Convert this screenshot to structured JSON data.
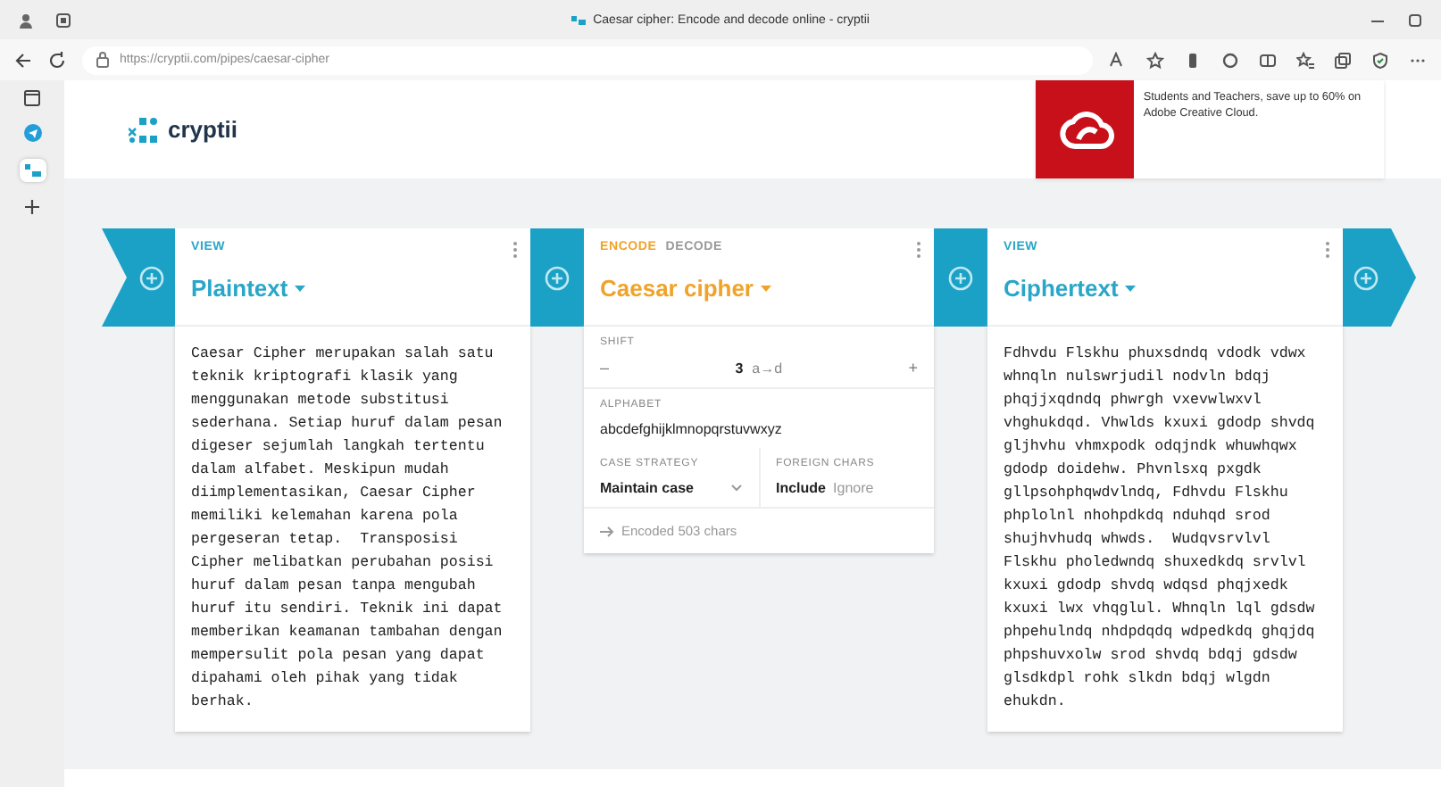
{
  "browser": {
    "title": "Caesar cipher: Encode and decode online - cryptii",
    "url": "https://cryptii.com/pipes/caesar-cipher"
  },
  "site": {
    "logo": "cryptii",
    "ad": {
      "text": "Students and Teachers, save up to 60% on Adobe Creative Cloud."
    }
  },
  "pipeline": [
    {
      "kind": "view",
      "label": "VIEW",
      "title": "Plaintext",
      "content": "Caesar Cipher merupakan salah satu teknik kriptografi klasik yang menggunakan metode substitusi sederhana. Setiap huruf dalam pesan digeser sejumlah langkah tertentu dalam alfabet. Meskipun mudah diimplementasikan, Caesar Cipher memiliki kelemahan karena pola pergeseran tetap.  Transposisi Cipher melibatkan perubahan posisi huruf dalam pesan tanpa mengubah huruf itu sendiri. Teknik ini dapat memberikan keamanan tambahan dengan mempersulit pola pesan yang dapat dipahami oleh pihak yang tidak berhak."
    },
    {
      "kind": "encoder",
      "modes": [
        {
          "label": "ENCODE",
          "selected": true
        },
        {
          "label": "DECODE",
          "selected": false
        }
      ],
      "title": "Caesar cipher",
      "shift": {
        "label": "SHIFT",
        "decrement": "–",
        "value": "3",
        "mapping": "a→d",
        "increment": "+"
      },
      "alphabet": {
        "label": "ALPHABET",
        "value": "abcdefghijklmnopqrstuvwxyz"
      },
      "case_strategy": {
        "label": "CASE STRATEGY",
        "value": "Maintain case"
      },
      "foreign_chars": {
        "label": "FOREIGN CHARS",
        "options": [
          {
            "label": "Include",
            "selected": true
          },
          {
            "label": "Ignore",
            "selected": false
          }
        ]
      },
      "status": "Encoded 503 chars"
    },
    {
      "kind": "view",
      "label": "VIEW",
      "title": "Ciphertext",
      "content": "Fdhvdu Flskhu phuxsdndq vdodk vdwx whnqln nulswrjudil nodvln bdqj phqjjxqdndq phwrgh vxevwlwxvl vhghukdqd. Vhwlds kxuxi gdodp shvdq gljhvhu vhmxpodk odqjndk whuwhqwx gdodp doidehw. Phvnlsxq pxgdk gllpsohphqwdvlndq, Fdhvdu Flskhu phplolnl nhohpdkdq nduhqd srod shujhvhudq whwds.  Wudqvsrvlvl Flskhu pholedwndq shuxedkdq srvlvl kxuxi gdodp shvdq wdqsd phqjxedk kxuxi lwx vhqglul. Whnqln lql gdsdw phpehulndq nhdpdqdq wdpedkdq ghqjdq phpshuvxolw srod shvdq bdqj gdsdw glsdkdpl rohk slkdn bdqj wlgdn ehukdn."
    }
  ]
}
